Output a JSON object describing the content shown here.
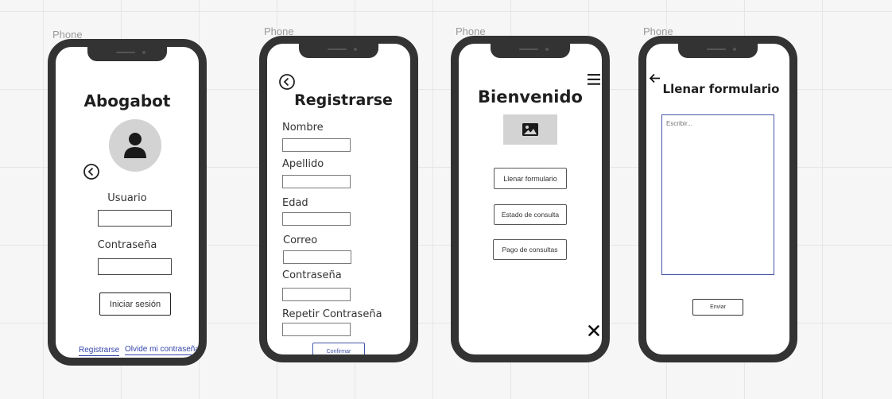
{
  "frame_labels": [
    "Phone",
    "Phone",
    "Phone",
    "Phone"
  ],
  "login": {
    "title": "Abogabot",
    "username_label": "Usuario",
    "password_label": "Contraseña",
    "login_button": "Iniciar sesión",
    "register_link": "Registrarse",
    "forgot_link": "Olvide mi contraseña"
  },
  "register": {
    "title": "Registrarse",
    "fields": [
      "Nombre",
      "Apellido",
      "Edad",
      "Correo",
      "Contraseña",
      "Repetir Contraseña"
    ],
    "confirm_button": "Confirmar"
  },
  "welcome": {
    "title": "Bienvenido",
    "buttons": [
      "Llenar formulario",
      "Estado de consulta",
      "Pago de consultas"
    ]
  },
  "form": {
    "title": "Llenar formulario",
    "textarea_placeholder": "Escribir...",
    "send_button": "Enviar"
  },
  "icons": [
    "back-icon",
    "user-avatar-icon",
    "image-icon",
    "menu-icon",
    "close-icon",
    "arrow-left-icon"
  ],
  "colors": {
    "phone_frame": "#333333",
    "accent": "#4455aa",
    "placeholder_gray": "#d3d3d3"
  }
}
